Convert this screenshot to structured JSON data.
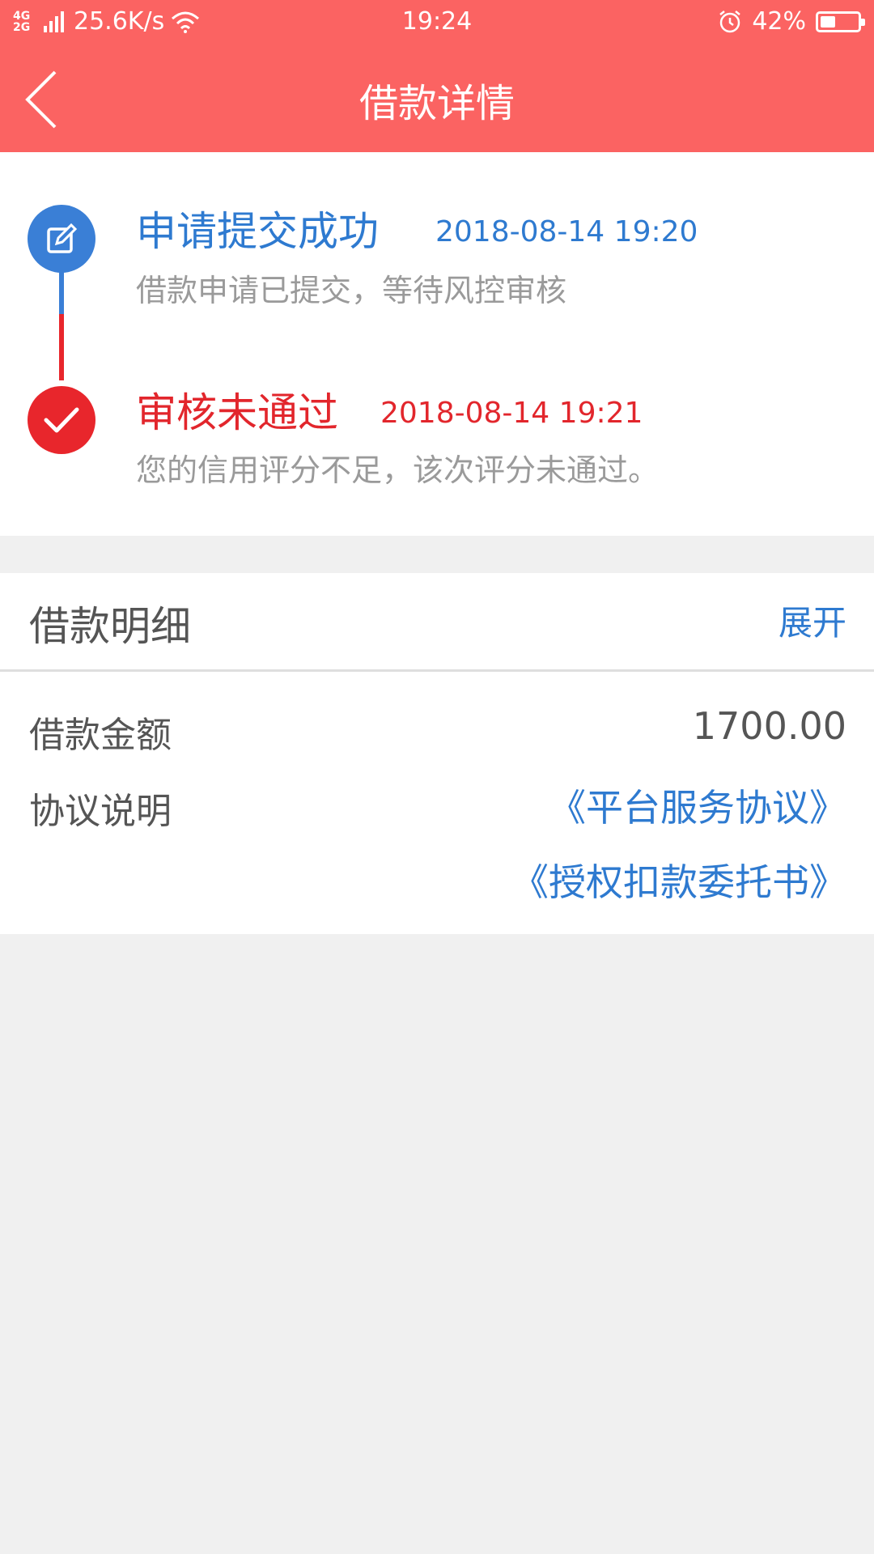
{
  "status_bar": {
    "network": "4G 2G",
    "speed": "25.6K/s",
    "time": "19:24",
    "battery": "42%",
    "battery_level": 0.42
  },
  "header": {
    "title": "借款详情"
  },
  "timeline": [
    {
      "title": "申请提交成功",
      "time": "2018-08-14 19:20",
      "desc": "借款申请已提交，等待风控审核",
      "color": "#2e7ad0",
      "icon": "edit-icon"
    },
    {
      "title": "审核未通过",
      "time": "2018-08-14 19:21",
      "desc": "您的信用评分不足，该次评分未通过。",
      "color": "#e2262c",
      "icon": "check-icon"
    }
  ],
  "details": {
    "title": "借款明细",
    "expand_label": "展开",
    "amount_label": "借款金额",
    "amount_value": "1700.00",
    "agreement_label": "协议说明",
    "agreements": [
      "《平台服务协议》",
      "《授权扣款委托书》"
    ]
  },
  "colors": {
    "header_bg": "#fb6362",
    "blue": "#2e7ad0",
    "red": "#e2262c",
    "page_bg": "#f0f0f0"
  }
}
